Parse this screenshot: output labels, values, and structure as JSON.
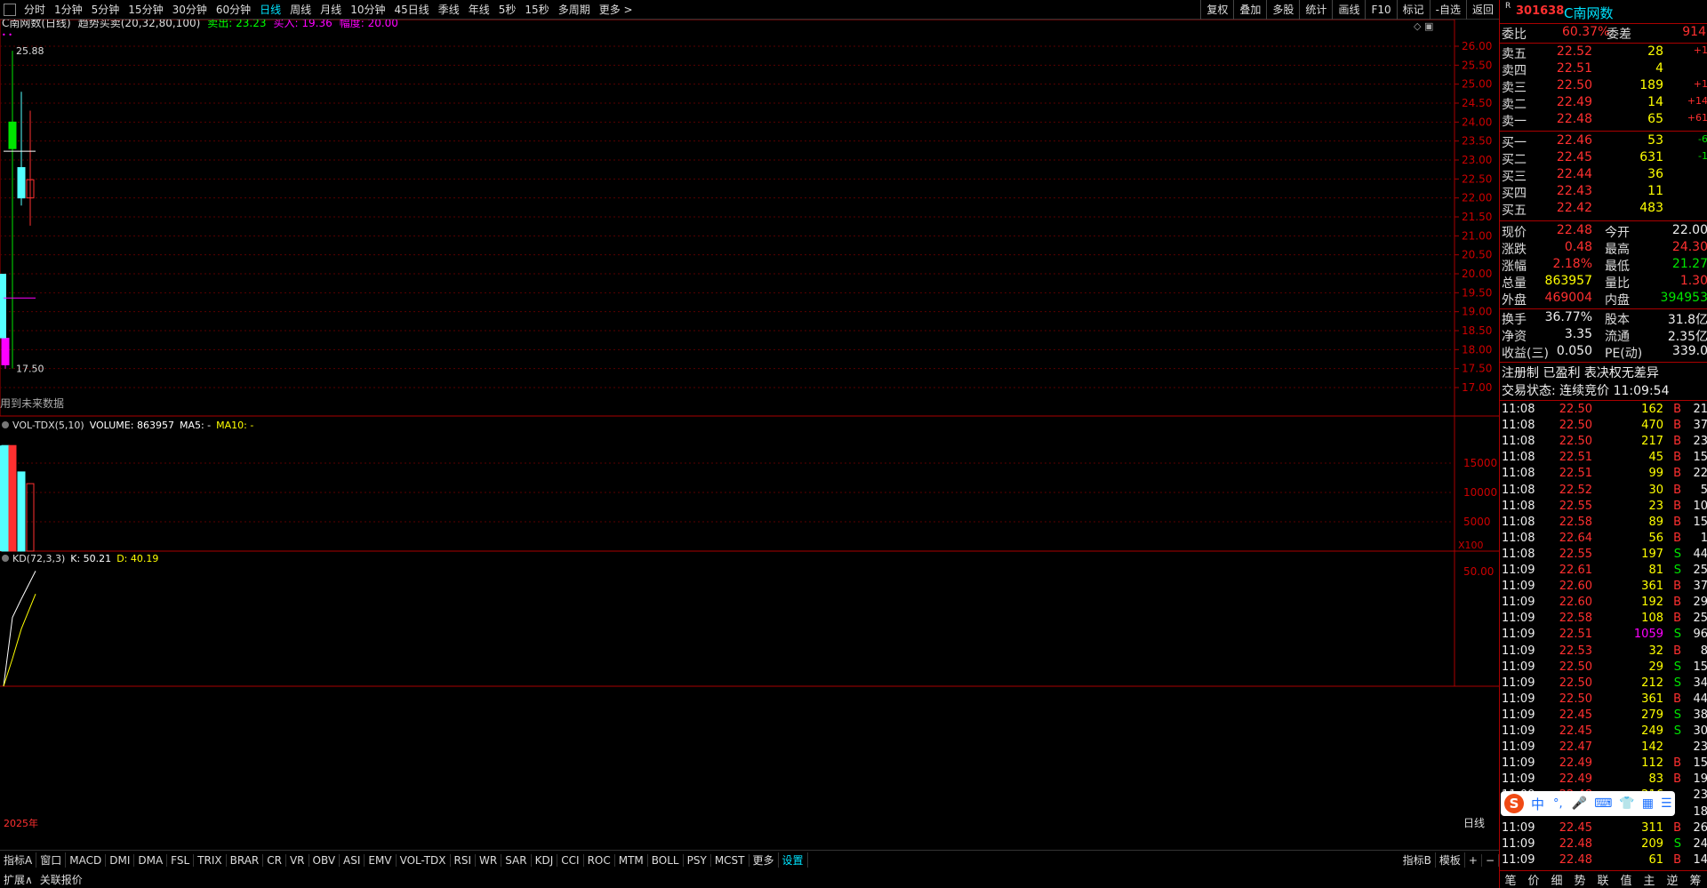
{
  "top_periods": [
    "分时",
    "1分钟",
    "5分钟",
    "15分钟",
    "30分钟",
    "60分钟",
    "日线",
    "周线",
    "月线",
    "10分钟",
    "45日线",
    "季线",
    "年线",
    "5秒",
    "15秒",
    "多周期",
    "更多 >"
  ],
  "top_active_index": 6,
  "right_buttons": [
    "复权",
    "叠加",
    "多股",
    "统计",
    "画线",
    "F10",
    "标记",
    "-自选",
    "返回"
  ],
  "main": {
    "title": "C南网数(日线)",
    "indicator": "趋势买卖(20,32,80,100)",
    "sell_label": "卖出: 23.23",
    "buy_label": "买入: 19.36",
    "amp_label": "幅度: 20.00",
    "high_mark": "25.88",
    "low_mark": "17.50",
    "future_note": "用到未来数据",
    "y_ticks": [
      "26.00",
      "25.50",
      "25.00",
      "24.50",
      "24.00",
      "23.50",
      "23.00",
      "22.50",
      "22.00",
      "21.50",
      "21.00",
      "20.50",
      "20.00",
      "19.50",
      "19.00",
      "18.50",
      "18.00",
      "17.50",
      "17.00"
    ]
  },
  "vol": {
    "title": "VOL-TDX(5,10)",
    "volume_label": "VOLUME: 863957",
    "ma5": "MA5: -",
    "ma10": "MA10: -",
    "y_ticks": [
      "15000",
      "10000",
      "5000"
    ],
    "unit": "X100"
  },
  "kd": {
    "title": "KD(72,3,3)",
    "k": "K: 50.21",
    "d": "D: 40.19",
    "y_ticks": [
      "50.00"
    ],
    "year": "2025年",
    "period": "日线"
  },
  "chart_data": {
    "type": "candlestick",
    "ylim": [
      16.8,
      26.2
    ],
    "candles": [
      {
        "open": 18.3,
        "close": 17.6,
        "high": 19.4,
        "low": 17.5,
        "color": "magenta"
      },
      {
        "open": 23.3,
        "close": 24.0,
        "high": 25.88,
        "low": 17.5,
        "color": "green"
      },
      {
        "open": 22.0,
        "close": 22.8,
        "high": 24.8,
        "low": 21.8,
        "color": "cyan"
      },
      {
        "open": 22.0,
        "close": 22.48,
        "high": 24.3,
        "low": 21.27,
        "color": "red"
      }
    ],
    "volumes": [
      18000,
      18000,
      13500,
      11500
    ],
    "sell_line": 23.23,
    "buy_line": 19.36,
    "k_series": [
      0,
      30,
      38,
      50.21
    ],
    "d_series": [
      0,
      12,
      25,
      40.19
    ],
    "kd_ylim": [
      0,
      55
    ]
  },
  "quote": {
    "code": "301638",
    "name": "C南网数",
    "wei_bi_label": "委比",
    "wei_bi": "60.37%",
    "wei_cha_label": "委差",
    "wei_cha": "914",
    "asks": [
      {
        "label": "卖五",
        "price": "22.52",
        "vol": "28",
        "chg": "+1"
      },
      {
        "label": "卖四",
        "price": "22.51",
        "vol": "4",
        "chg": ""
      },
      {
        "label": "卖三",
        "price": "22.50",
        "vol": "189",
        "chg": "+1"
      },
      {
        "label": "卖二",
        "price": "22.49",
        "vol": "14",
        "chg": "+14"
      },
      {
        "label": "卖一",
        "price": "22.48",
        "vol": "65",
        "chg": "+61"
      }
    ],
    "bids": [
      {
        "label": "买一",
        "price": "22.46",
        "vol": "53",
        "chg": "-6"
      },
      {
        "label": "买二",
        "price": "22.45",
        "vol": "631",
        "chg": "-1"
      },
      {
        "label": "买三",
        "price": "22.44",
        "vol": "36",
        "chg": ""
      },
      {
        "label": "买四",
        "price": "22.43",
        "vol": "11",
        "chg": ""
      },
      {
        "label": "买五",
        "price": "22.42",
        "vol": "483",
        "chg": ""
      }
    ],
    "stats": [
      {
        "l1": "现价",
        "v1": "22.48",
        "c1": "red",
        "l2": "今开",
        "v2": "22.00",
        "c2": "wht"
      },
      {
        "l1": "涨跌",
        "v1": "0.48",
        "c1": "red",
        "l2": "最高",
        "v2": "24.30",
        "c2": "red"
      },
      {
        "l1": "涨幅",
        "v1": "2.18%",
        "c1": "red",
        "l2": "最低",
        "v2": "21.27",
        "c2": "grn"
      },
      {
        "l1": "总量",
        "v1": "863957",
        "c1": "yel",
        "l2": "量比",
        "v2": "1.30",
        "c2": "red"
      },
      {
        "l1": "外盘",
        "v1": "469004",
        "c1": "red",
        "l2": "内盘",
        "v2": "394953",
        "c2": "grn"
      }
    ],
    "stats2": [
      {
        "l1": "换手",
        "v1": "36.77%",
        "l2": "股本",
        "v2": "31.8亿"
      },
      {
        "l1": "净资",
        "v1": "3.35",
        "l2": "流通",
        "v2": "2.35亿"
      },
      {
        "l1": "收益(三)",
        "v1": "0.050",
        "l2": "PE(动)",
        "v2": "339.0"
      }
    ],
    "status1": "注册制 已盈利 表决权无差异",
    "status2": "交易状态: 连续竞价 11:09:54",
    "ticks": [
      {
        "t": "11:08",
        "p": "22.50",
        "v": "162",
        "s": "B",
        "n": "21"
      },
      {
        "t": "11:08",
        "p": "22.50",
        "v": "470",
        "s": "B",
        "n": "37"
      },
      {
        "t": "11:08",
        "p": "22.50",
        "v": "217",
        "s": "B",
        "n": "23"
      },
      {
        "t": "11:08",
        "p": "22.51",
        "v": "45",
        "s": "B",
        "n": "15"
      },
      {
        "t": "11:08",
        "p": "22.51",
        "v": "99",
        "s": "B",
        "n": "22"
      },
      {
        "t": "11:08",
        "p": "22.52",
        "v": "30",
        "s": "B",
        "n": "5"
      },
      {
        "t": "11:08",
        "p": "22.55",
        "v": "23",
        "s": "B",
        "n": "10"
      },
      {
        "t": "11:08",
        "p": "22.58",
        "v": "89",
        "s": "B",
        "n": "15"
      },
      {
        "t": "11:08",
        "p": "22.64",
        "v": "56",
        "s": "B",
        "n": "1"
      },
      {
        "t": "11:08",
        "p": "22.55",
        "v": "197",
        "s": "S",
        "n": "44"
      },
      {
        "t": "11:09",
        "p": "22.61",
        "v": "81",
        "s": "S",
        "n": "25"
      },
      {
        "t": "11:09",
        "p": "22.60",
        "v": "361",
        "s": "B",
        "n": "37"
      },
      {
        "t": "11:09",
        "p": "22.60",
        "v": "192",
        "s": "B",
        "n": "29"
      },
      {
        "t": "11:09",
        "p": "22.58",
        "v": "108",
        "s": "B",
        "n": "25"
      },
      {
        "t": "11:09",
        "p": "22.51",
        "v": "1059",
        "s": "S",
        "n": "96"
      },
      {
        "t": "11:09",
        "p": "22.53",
        "v": "32",
        "s": "B",
        "n": "8"
      },
      {
        "t": "11:09",
        "p": "22.50",
        "v": "29",
        "s": "S",
        "n": "15"
      },
      {
        "t": "11:09",
        "p": "22.50",
        "v": "212",
        "s": "S",
        "n": "34"
      },
      {
        "t": "11:09",
        "p": "22.50",
        "v": "361",
        "s": "B",
        "n": "44"
      },
      {
        "t": "11:09",
        "p": "22.45",
        "v": "279",
        "s": "S",
        "n": "38"
      },
      {
        "t": "11:09",
        "p": "22.45",
        "v": "249",
        "s": "S",
        "n": "30"
      },
      {
        "t": "11:09",
        "p": "22.47",
        "v": "142",
        "s": "",
        "n": "23"
      },
      {
        "t": "11:09",
        "p": "22.49",
        "v": "112",
        "s": "B",
        "n": "15"
      },
      {
        "t": "11:09",
        "p": "22.49",
        "v": "83",
        "s": "B",
        "n": "19"
      },
      {
        "t": "11:09",
        "p": "22.48",
        "v": "216",
        "s": "",
        "n": "23"
      },
      {
        "t": "11:09",
        "p": "",
        "v": "",
        "s": "",
        "n": "18"
      },
      {
        "t": "11:09",
        "p": "22.45",
        "v": "311",
        "s": "B",
        "n": "26"
      },
      {
        "t": "11:09",
        "p": "22.48",
        "v": "209",
        "s": "S",
        "n": "24"
      },
      {
        "t": "11:09",
        "p": "22.48",
        "v": "61",
        "s": "B",
        "n": "14"
      }
    ],
    "tabs": [
      "笔",
      "价",
      "细",
      "势",
      "联",
      "值",
      "主",
      "逆",
      "筹"
    ]
  },
  "ind_tabs": [
    "指标A",
    "窗口",
    "MACD",
    "DMI",
    "DMA",
    "FSL",
    "TRIX",
    "BRAR",
    "CR",
    "VR",
    "OBV",
    "ASI",
    "EMV",
    "VOL-TDX",
    "RSI",
    "WR",
    "SAR",
    "KDJ",
    "CCI",
    "ROC",
    "MTM",
    "BOLL",
    "PSY",
    "MCST",
    "更多",
    "设置"
  ],
  "ind_right": [
    "指标B",
    "模板",
    "+",
    "−"
  ],
  "ext_tabs": [
    "扩展∧",
    "关联报价"
  ],
  "ime": "中"
}
